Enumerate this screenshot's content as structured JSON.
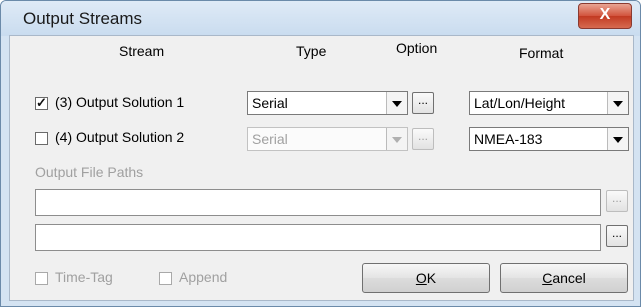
{
  "window": {
    "title": "Output Streams",
    "close_icon": "X"
  },
  "headers": {
    "stream": "Stream",
    "type": "Type",
    "option": "Option",
    "format": "Format"
  },
  "rows": [
    {
      "checked": true,
      "label": "(3) Output Solution 1",
      "type": "Serial",
      "option": "...",
      "format": "Lat/Lon/Height"
    },
    {
      "checked": false,
      "label": "(4) Output Solution 2",
      "type": "Serial",
      "option": "...",
      "format": "NMEA-183"
    }
  ],
  "paths": {
    "label": "Output File Paths",
    "path1": "",
    "path2": "",
    "browse": "..."
  },
  "options": {
    "timetag": "Time-Tag",
    "append": "Append"
  },
  "buttons": {
    "ok_key": "O",
    "ok_rest": "K",
    "cancel_key": "C",
    "cancel_rest": "ancel"
  }
}
